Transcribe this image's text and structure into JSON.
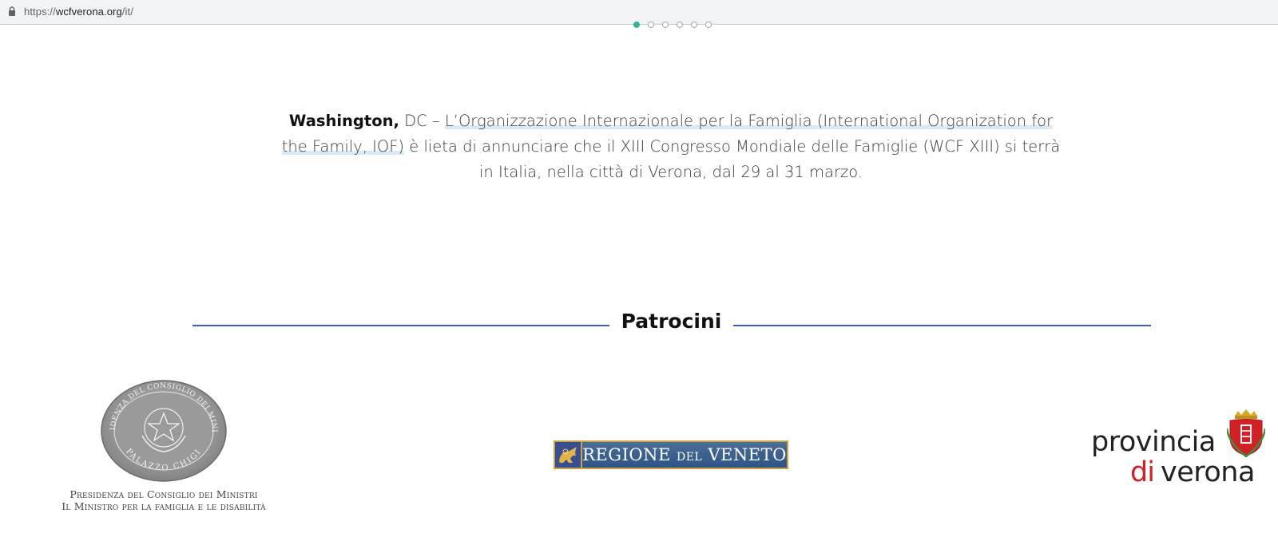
{
  "browser": {
    "url_scheme": "https://",
    "url_host": "wcfverona.org",
    "url_path": "/it/"
  },
  "carousel": {
    "dot_count": 6,
    "active_index": 0
  },
  "announcement": {
    "lead_bold": "Washington,",
    "lead_rest": " DC – ",
    "highlight": "L’Organizzazione Internazionale per la Famiglia (International Organization for the Family, IOF)",
    "body": " è lieta di annunciare che il XIII Congresso Mondiale delle Famiglie (WCF XIII) si terrà in Italia, nella città di Verona, dal 29 al 31 marzo."
  },
  "section": {
    "title": "Patrocini"
  },
  "sponsors": {
    "presidenza": {
      "seal_top": "PRESIDENZA DEL CONSIGLIO DEI MINISTRI",
      "seal_bottom": "PALAZZO CHIGI",
      "line1": "Presidenza del Consiglio dei Ministri",
      "line2": "Il Ministro per la famiglia e le disabilità"
    },
    "veneto": {
      "word1": "REGIONE ",
      "word2": "DEL",
      "word3": " VENETO"
    },
    "provincia": {
      "line1": "provincia",
      "di": "di",
      "line2": "verona"
    }
  },
  "colors": {
    "accent_line": "#3a5bd0",
    "provincia_red": "#d32027",
    "veneto_blue": "#2f5d8e",
    "veneto_gold": "#c9a348"
  }
}
